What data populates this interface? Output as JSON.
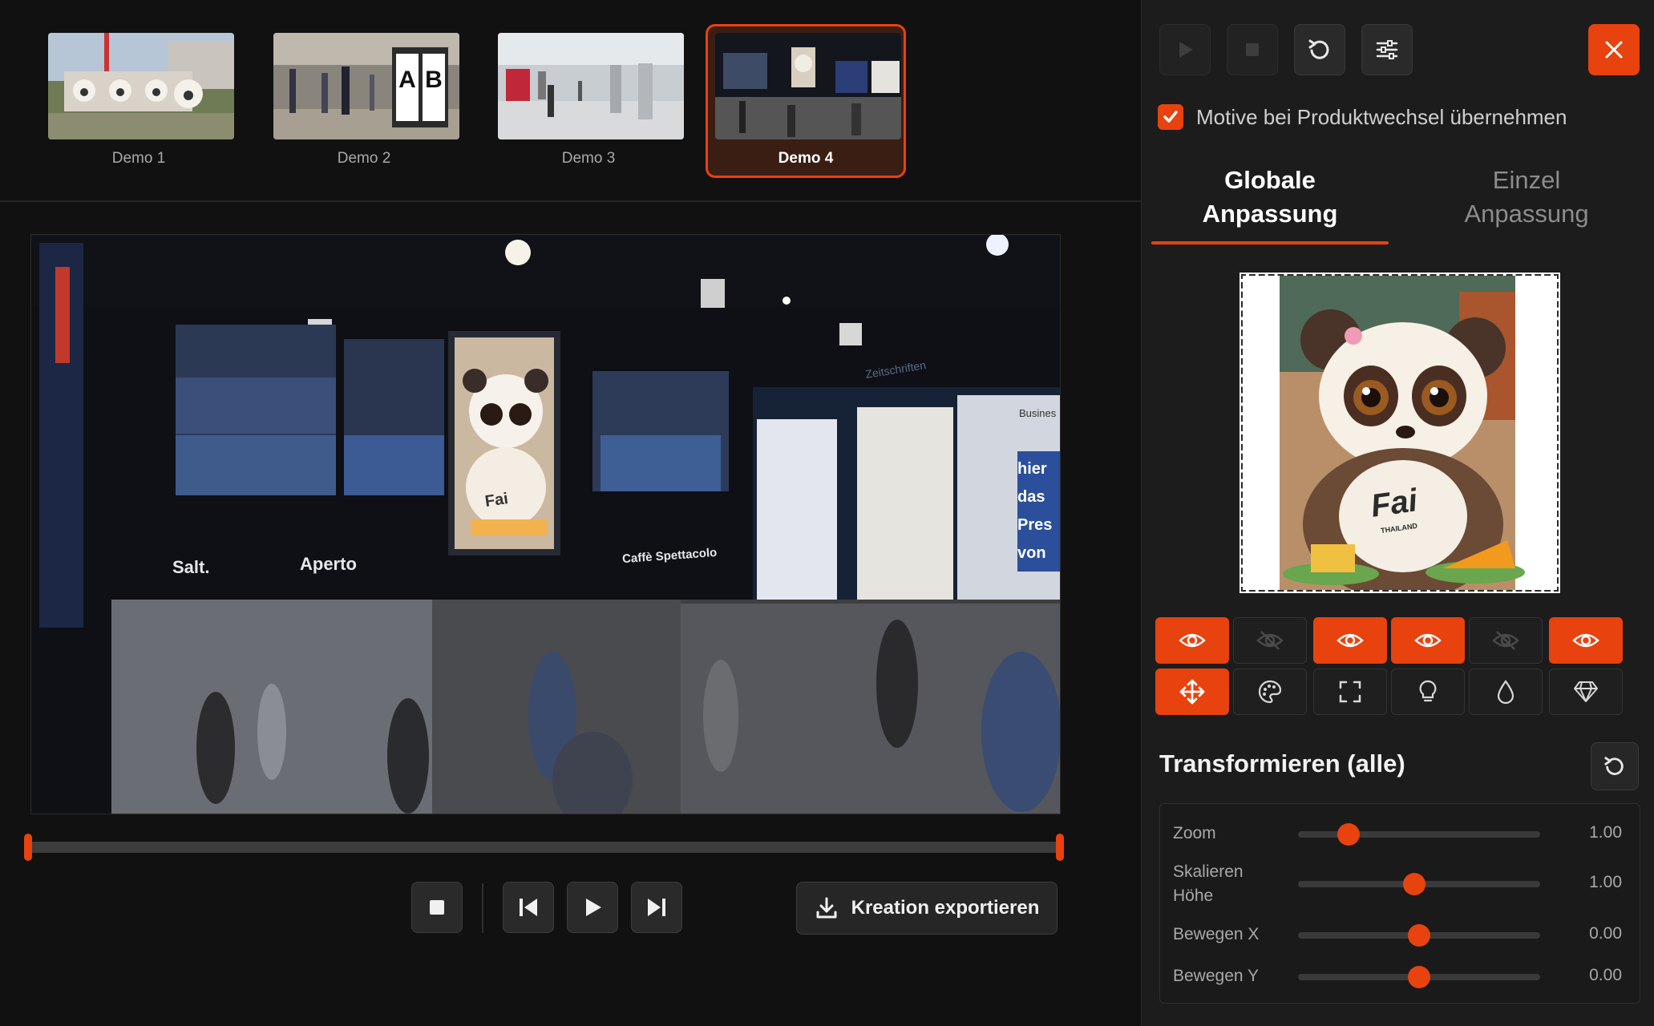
{
  "thumbnails": [
    {
      "label": "Demo 1",
      "active": false
    },
    {
      "label": "Demo 2",
      "active": false
    },
    {
      "label": "Demo 3",
      "active": false
    },
    {
      "label": "Demo 4",
      "active": true
    }
  ],
  "stage_signage": {
    "salt": "Salt.",
    "aperto": "Aperto",
    "caffe": "Caffè Spettacolo",
    "zeitschriften": "Zeitschriften",
    "poster_lines": [
      "hier",
      "das",
      "Pres",
      "von"
    ],
    "business": "Busines"
  },
  "demo2_panels": [
    "A",
    "B"
  ],
  "motif_text": "Fai",
  "motif_subtext": "THAILAND",
  "controls": {
    "export_label": "Kreation exportieren"
  },
  "panel": {
    "keep_motifs_label": "Motive bei Produktwechsel übernehmen",
    "keep_motifs_checked": true,
    "tabs": [
      {
        "line1": "Globale",
        "line2": "Anpassung",
        "active": true
      },
      {
        "line1": "Einzel",
        "line2": "Anpassung",
        "active": false
      }
    ],
    "visibility_row": [
      true,
      false,
      true,
      true,
      false,
      true
    ],
    "tool_row": [
      "move-icon",
      "palette-icon",
      "fit-frame-icon",
      "lightbulb-icon",
      "drop-icon",
      "diamond-icon"
    ],
    "active_tool": "move-icon",
    "transform_title": "Transformieren (alle)",
    "sliders": [
      {
        "label": "Zoom",
        "value": "1.00",
        "level": 0.21
      },
      {
        "label": "Skalieren\nHöhe",
        "value": "1.00",
        "level": 0.48
      },
      {
        "label": "Bewegen X",
        "value": "0.00",
        "level": 0.5
      },
      {
        "label": "Bewegen Y",
        "value": "0.00",
        "level": 0.5
      }
    ]
  },
  "colors": {
    "accent": "#e8420e",
    "background": "#111111",
    "panel": "#1c1c1c"
  }
}
